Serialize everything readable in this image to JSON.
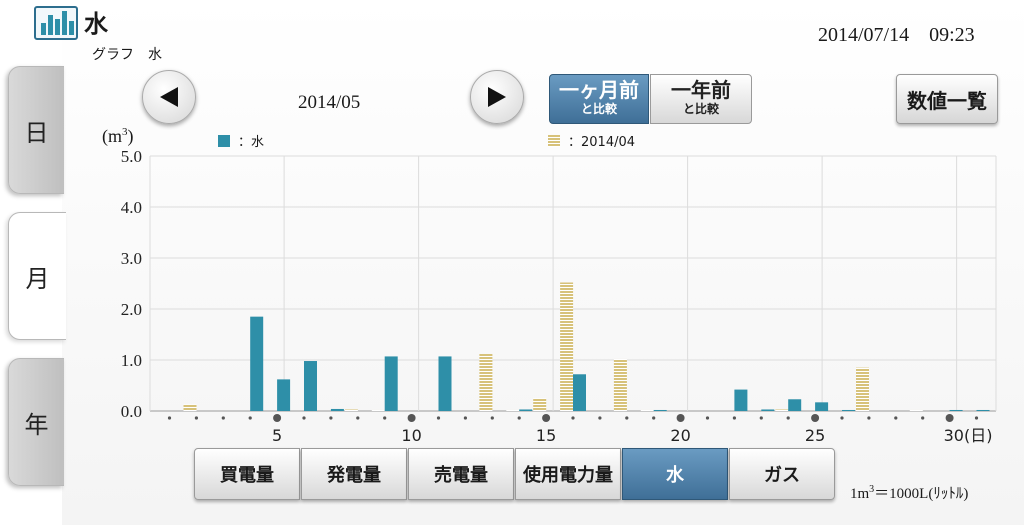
{
  "header": {
    "title": "水",
    "subtitle": "グラフ　水",
    "datetime": "2014/07/14　09:23"
  },
  "side_tabs": [
    {
      "label": "日",
      "active": false
    },
    {
      "label": "月",
      "active": true
    },
    {
      "label": "年",
      "active": false
    }
  ],
  "nav": {
    "period": "2014/05",
    "prev_icon": "triangle-left-icon",
    "next_icon": "triangle-right-icon"
  },
  "compare": {
    "month": {
      "line1": "一ヶ月前",
      "line2": "と比較",
      "active": true
    },
    "year": {
      "line1": "一年前",
      "line2": "と比較",
      "active": false
    }
  },
  "list_button": "数値一覧",
  "unit": {
    "base": "(m",
    "sup": "3",
    "close": ")"
  },
  "legend": [
    {
      "label": "：水",
      "color": "#2e8fa8",
      "style": "solid"
    },
    {
      "label": "：2014/04",
      "color": "#d7c27a",
      "style": "striped"
    }
  ],
  "categories": [
    {
      "label": "買電量",
      "active": false
    },
    {
      "label": "発電量",
      "active": false
    },
    {
      "label": "売電量",
      "active": false
    },
    {
      "label": "使用電力量",
      "active": false
    },
    {
      "label": "水",
      "active": true
    },
    {
      "label": "ガス",
      "active": false
    }
  ],
  "unit_note": {
    "pre": "1m",
    "sup": "3",
    "post": "＝1000L(ﾘｯﾄﾙ)"
  },
  "colors": {
    "current": "#2e8fa8",
    "previous": "#d7c27a",
    "accent": "#4f81ad"
  },
  "chart_data": {
    "type": "bar",
    "title": "",
    "ylabel": "(m3)",
    "xlabel": "(日)",
    "ylim": [
      0,
      5.0
    ],
    "yticks": [
      "0.0",
      "1.0",
      "2.0",
      "3.0",
      "4.0",
      "5.0"
    ],
    "xticks": [
      5,
      10,
      15,
      20,
      25,
      30
    ],
    "xtick_suffix": "(日)",
    "x": [
      1,
      2,
      3,
      4,
      5,
      6,
      7,
      8,
      9,
      10,
      11,
      12,
      13,
      14,
      15,
      16,
      17,
      18,
      19,
      20,
      21,
      22,
      23,
      24,
      25,
      26,
      27,
      28,
      29,
      30,
      31
    ],
    "series": [
      {
        "name": "水",
        "values": [
          0,
          0,
          0,
          1.85,
          0.62,
          0.98,
          0.04,
          0,
          1.07,
          0,
          1.07,
          0,
          0,
          0.03,
          0,
          0.72,
          0,
          0,
          0.02,
          0,
          0,
          0.42,
          0.03,
          0.23,
          0.17,
          0.02,
          0,
          0,
          0,
          0.02,
          0.02
        ]
      },
      {
        "name": "2014/04",
        "values": [
          0.13,
          0,
          0,
          0,
          0,
          0,
          0.03,
          0.02,
          0,
          0,
          0,
          1.12,
          0.02,
          0.25,
          2.52,
          0,
          1.02,
          0.02,
          0,
          0,
          0,
          0,
          0.03,
          0,
          0,
          0.85,
          0,
          0.02,
          0,
          0,
          0
        ]
      }
    ],
    "grid": true
  }
}
